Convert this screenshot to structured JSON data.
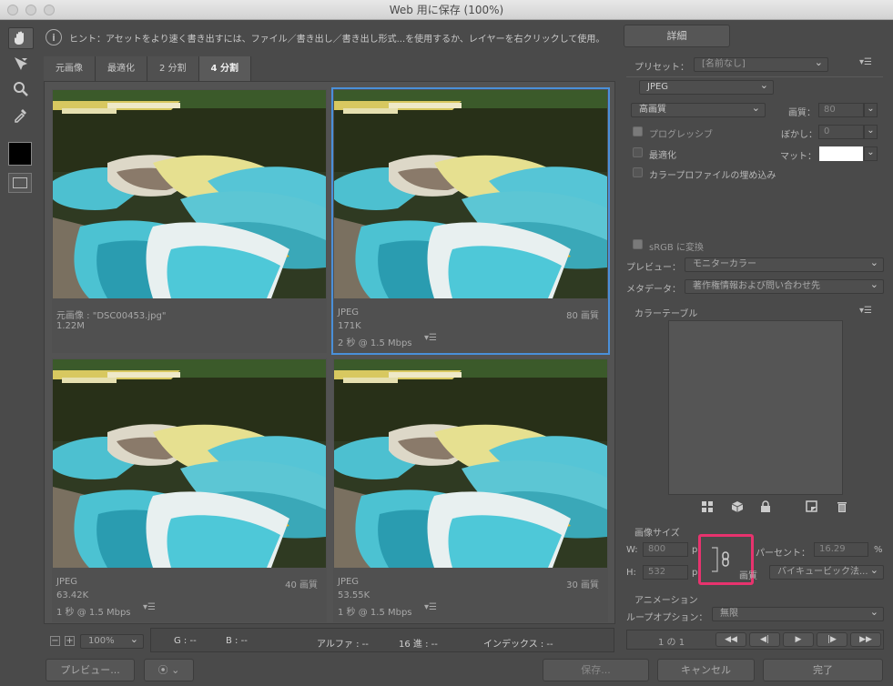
{
  "window": {
    "title": "Web 用に保存 (100%)"
  },
  "hint": "ヒント：アセットをより速く書き出すには、ファイル／書き出し／書き出し形式...を使用するか、レイヤーを右クリックして使用。",
  "detail_button": "詳細",
  "tabs": [
    "元画像",
    "最適化",
    "2 分割",
    "4 分割"
  ],
  "panes": [
    {
      "line1": "元画像 : \"DSC00453.jpg\"",
      "line2": "1.22M",
      "line3": "",
      "quality": ""
    },
    {
      "line1": "JPEG",
      "line2": "171K",
      "line3": "2 秒 @ 1.5 Mbps",
      "quality": "80 画質"
    },
    {
      "line1": "JPEG",
      "line2": "63.42K",
      "line3": "1 秒 @ 1.5 Mbps",
      "quality": "40 画質"
    },
    {
      "line1": "JPEG",
      "line2": "53.55K",
      "line3": "1 秒 @ 1.5 Mbps",
      "quality": "30 画質"
    }
  ],
  "settings": {
    "preset_label": "プリセット：",
    "preset_value": "[名前なし]",
    "format": "JPEG",
    "quality_preset": "高画質",
    "quality_label": "画質：",
    "quality_value": "80",
    "progressive": "プログレッシブ",
    "blur_label": "ぼかし：",
    "blur_value": "0",
    "optimize": "最適化",
    "matte_label": "マット：",
    "embed_profile": "カラープロファイルの埋め込み",
    "srgb": "sRGB に変換",
    "preview_label": "プレビュー：",
    "preview_value": "モニターカラー",
    "metadata_label": "メタデータ：",
    "metadata_value": "著作権情報および問い合わせ先",
    "color_table": "カラーテーブル"
  },
  "image_size": {
    "header": "画像サイズ",
    "w_label": "W:",
    "w_value": "800",
    "h_label": "H:",
    "h_value": "532",
    "unit": "p",
    "percent_label": "パーセント：",
    "percent_value": "16.29",
    "percent_unit": "%",
    "quality_label": "画質",
    "quality_value": "バイキュービック法..."
  },
  "animation": {
    "header": "アニメーション",
    "loop_label": "ループオプション：",
    "loop_value": "無限",
    "frame": "1 の 1"
  },
  "zoom": "100%",
  "status": {
    "g": "G : --",
    "b": "B : --",
    "alpha": "アルファ : --",
    "hex": "16 進 : --",
    "index": "インデックス : --"
  },
  "buttons": {
    "preview": "プレビュー...",
    "save": "保存...",
    "cancel": "キャンセル",
    "done": "完了"
  },
  "colors": {
    "selection": "#4a90d9",
    "highlight": "#e8336e"
  }
}
